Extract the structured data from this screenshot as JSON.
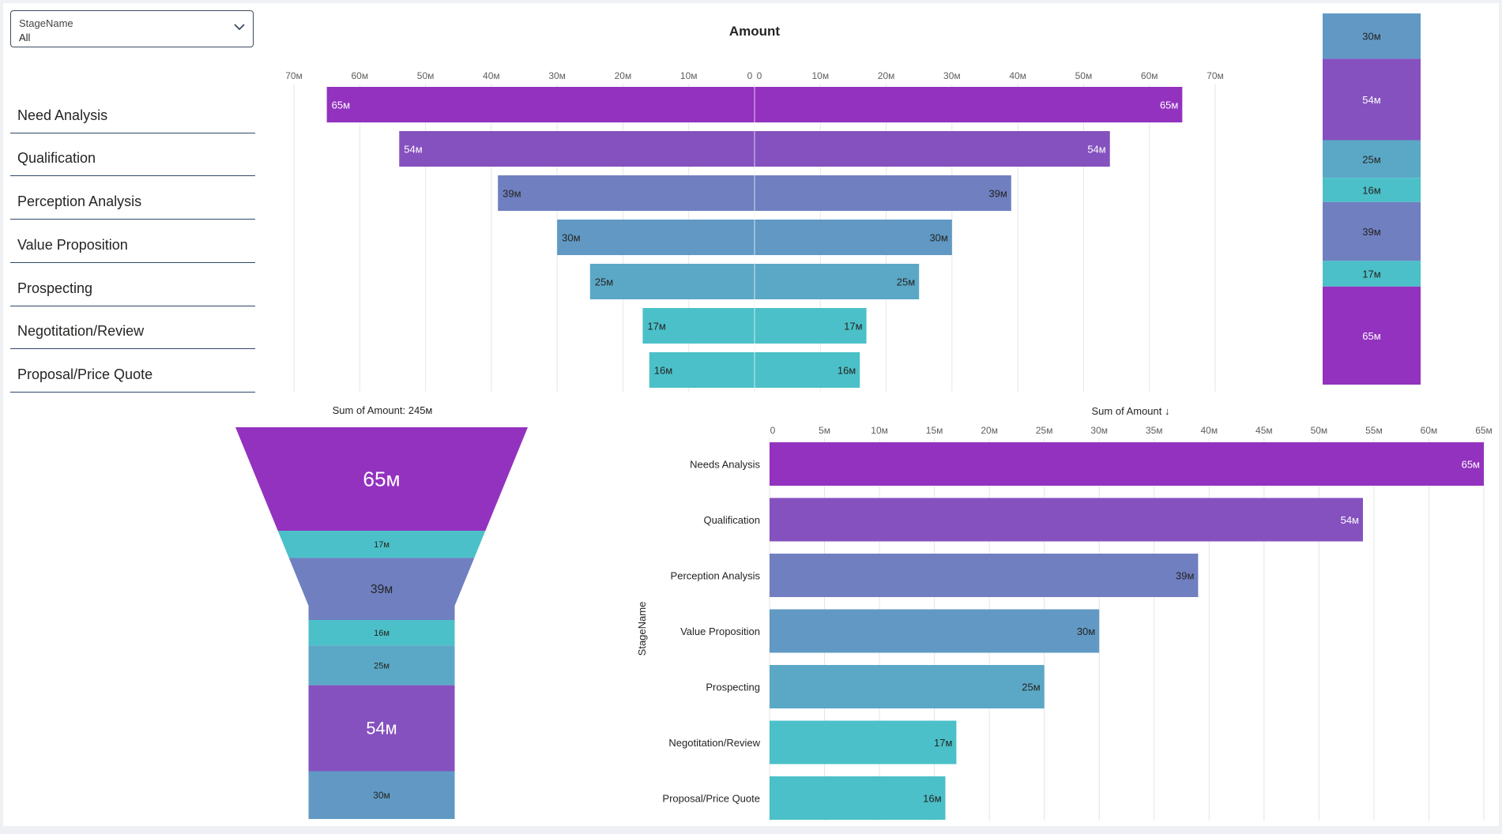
{
  "slicer": {
    "title": "StageName",
    "selected": "All",
    "items": [
      "Need Analysis",
      "Qualification",
      "Perception Analysis",
      "Value Proposition",
      "Prospecting",
      "Negotitation/Review",
      "Proposal/Price Quote"
    ],
    "icon": "chevron-down-icon"
  },
  "colors": {
    "need": "#9332bf",
    "qual": "#8551bf",
    "perc": "#6f7fc0",
    "value": "#6199c4",
    "prosp": "#5ba8c6",
    "nego": "#4bc0c8",
    "prop": "#4bc0c8",
    "grid": "#e6e6e6",
    "axis": "#605e5c"
  },
  "chart_data": [
    {
      "type": "bar",
      "subtype": "butterfly",
      "title": "Amount",
      "categories": [
        "Need Analysis",
        "Qualification",
        "Perception Analysis",
        "Value Proposition",
        "Prospecting",
        "Negotitation/Review",
        "Proposal/Price Quote"
      ],
      "values": [
        65,
        54,
        39,
        30,
        25,
        17,
        16
      ],
      "value_labels": [
        "65м",
        "54м",
        "39м",
        "30м",
        "25м",
        "17м",
        "16м"
      ],
      "xlim": [
        -70,
        70
      ],
      "tick_labels": [
        "70м",
        "60м",
        "50м",
        "40м",
        "30м",
        "20м",
        "10м",
        "0",
        "0",
        "10м",
        "20м",
        "30м",
        "40м",
        "50м",
        "60м",
        "70м"
      ],
      "unit": "M"
    },
    {
      "type": "bar",
      "subtype": "stacked-column",
      "segments": [
        {
          "value": 30,
          "label": "30м",
          "color_key": "value"
        },
        {
          "value": 54,
          "label": "54м",
          "color_key": "qual"
        },
        {
          "value": 25,
          "label": "25м",
          "color_key": "prosp"
        },
        {
          "value": 16,
          "label": "16м",
          "color_key": "prop"
        },
        {
          "value": 39,
          "label": "39м",
          "color_key": "perc"
        },
        {
          "value": 17,
          "label": "17м",
          "color_key": "nego"
        },
        {
          "value": 65,
          "label": "65м",
          "color_key": "need"
        }
      ]
    },
    {
      "type": "bar",
      "subtype": "funnel",
      "title": "Sum of Amount: 245м",
      "segments": [
        {
          "value": 65,
          "label": "65м",
          "color_key": "need"
        },
        {
          "value": 17,
          "label": "17м",
          "color_key": "nego"
        },
        {
          "value": 39,
          "label": "39м",
          "color_key": "perc"
        },
        {
          "value": 16,
          "label": "16м",
          "color_key": "prop"
        },
        {
          "value": 25,
          "label": "25м",
          "color_key": "prosp"
        },
        {
          "value": 54,
          "label": "54м",
          "color_key": "qual"
        },
        {
          "value": 30,
          "label": "30м",
          "color_key": "value"
        }
      ]
    },
    {
      "type": "bar",
      "orientation": "horizontal",
      "title": "Sum of Amount ↓",
      "ylabel": "StageName",
      "categories": [
        "Needs Analysis",
        "Qualification",
        "Perception Analysis",
        "Value Proposition",
        "Prospecting",
        "Negotitation/Review",
        "Proposal/Price Quote"
      ],
      "values": [
        65,
        54,
        39,
        30,
        25,
        17,
        16
      ],
      "value_labels": [
        "65м",
        "54м",
        "39м",
        "30м",
        "25м",
        "17м",
        "16м"
      ],
      "xlim": [
        0,
        65
      ],
      "tick_values": [
        0,
        5,
        10,
        15,
        20,
        25,
        30,
        35,
        40,
        45,
        50,
        55,
        60,
        65
      ],
      "tick_labels": [
        "0",
        "5м",
        "10м",
        "15м",
        "20м",
        "25м",
        "30м",
        "35м",
        "40м",
        "45м",
        "50м",
        "55м",
        "60м",
        "65м"
      ],
      "grid": true
    }
  ]
}
